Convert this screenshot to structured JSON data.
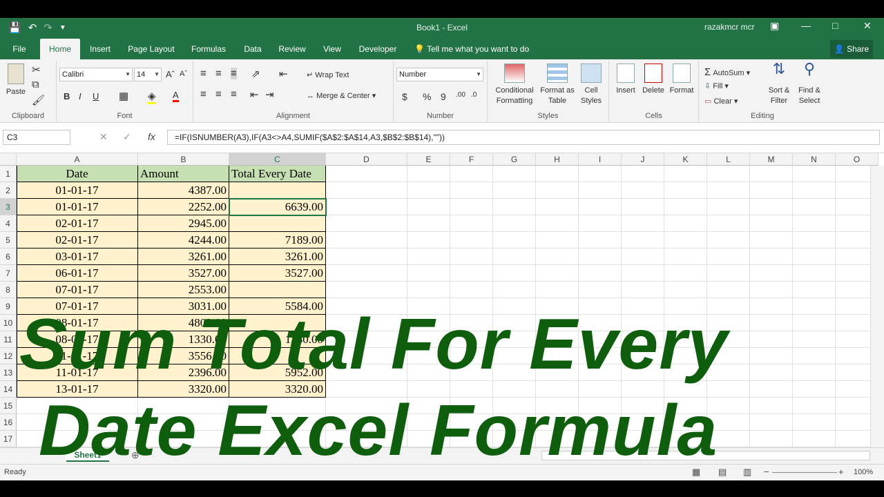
{
  "window": {
    "title": "Book1  -  Excel",
    "user": "razakmcr mcr"
  },
  "tabs": [
    {
      "label": "File"
    },
    {
      "label": "Home"
    },
    {
      "label": "Insert"
    },
    {
      "label": "Page Layout"
    },
    {
      "label": "Formulas"
    },
    {
      "label": "Data"
    },
    {
      "label": "Review"
    },
    {
      "label": "View"
    },
    {
      "label": "Developer"
    }
  ],
  "tell_me": "Tell me what you want to do",
  "share": "Share",
  "ribbon": {
    "clipboard": {
      "paste": "Paste",
      "label": "Clipboard"
    },
    "font": {
      "name": "Calibri",
      "size": "14",
      "bold": "B",
      "italic": "I",
      "underline": "U",
      "label": "Font"
    },
    "alignment": {
      "wrap": "Wrap Text",
      "merge": "Merge & Center",
      "label": "Alignment"
    },
    "number": {
      "format": "Number",
      "currency": "$",
      "percent": "%",
      "comma": "9",
      "label": "Number"
    },
    "styles": {
      "conditional": "Conditional",
      "conditional2": "Formatting",
      "format_table": "Format as",
      "format_table2": "Table",
      "cell_styles": "Cell",
      "cell_styles2": "Styles",
      "label": "Styles"
    },
    "cells": {
      "insert": "Insert",
      "delete": "Delete",
      "format": "Format",
      "label": "Cells"
    },
    "editing": {
      "autosum": "AutoSum",
      "fill": "Fill",
      "clear": "Clear",
      "sort": "Sort &",
      "sort2": "Filter",
      "find": "Find &",
      "find2": "Select",
      "label": "Editing"
    }
  },
  "formula_bar": {
    "name_box": "C3",
    "fx": "fx",
    "formula": "=IF(ISNUMBER(A3),IF(A3<>A4,SUMIF($A$2:$A$14,A3,$B$2:$B$14),\"\"))"
  },
  "columns": [
    "A",
    "B",
    "C",
    "D",
    "E",
    "F",
    "G",
    "H",
    "I",
    "J",
    "K",
    "L",
    "M",
    "N",
    "O"
  ],
  "rows": [
    "1",
    "2",
    "3",
    "4",
    "5",
    "6",
    "7",
    "8",
    "9",
    "10",
    "11",
    "12",
    "13",
    "14",
    "15",
    "16",
    "17"
  ],
  "table": {
    "headers": [
      "Date",
      "Amount",
      "Total Every Date"
    ],
    "rows": [
      [
        "01-01-17",
        "4387.00",
        ""
      ],
      [
        "01-01-17",
        "2252.00",
        "6639.00"
      ],
      [
        "02-01-17",
        "2945.00",
        ""
      ],
      [
        "02-01-17",
        "4244.00",
        "7189.00"
      ],
      [
        "03-01-17",
        "3261.00",
        "3261.00"
      ],
      [
        "06-01-17",
        "3527.00",
        "3527.00"
      ],
      [
        "07-01-17",
        "2553.00",
        ""
      ],
      [
        "07-01-17",
        "3031.00",
        "5584.00"
      ],
      [
        "08-01-17",
        "4803.00",
        ""
      ],
      [
        "08-01-17",
        "1330.00",
        "1330.00"
      ],
      [
        "11-01-17",
        "3556.00",
        ""
      ],
      [
        "11-01-17",
        "2396.00",
        "5952.00"
      ],
      [
        "13-01-17",
        "3320.00",
        "3320.00"
      ]
    ]
  },
  "sheet_tab": "Sheet1",
  "status": {
    "ready": "Ready",
    "zoom": "100%"
  },
  "overlay": {
    "line1": "Sum Total For Every",
    "line2": "Date  Excel Formula",
    "color": "#0e5e0e"
  },
  "colors": {
    "excel_green": "#217346",
    "header_fill": "#c6e0b4",
    "data_fill": "#fff2cc"
  }
}
